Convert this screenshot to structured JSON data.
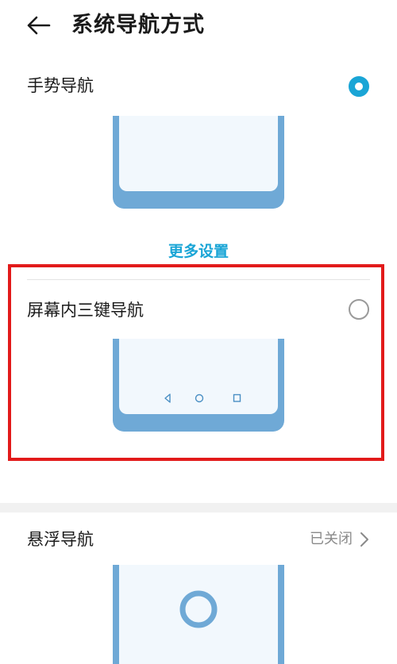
{
  "header": {
    "title": "系统导航方式"
  },
  "gesture_nav": {
    "label": "手势导航",
    "selected": true,
    "more_settings_label": "更多设置"
  },
  "three_key_nav": {
    "label": "屏幕内三键导航",
    "selected": false,
    "buttons": [
      "back-icon",
      "home-icon",
      "recents-icon"
    ]
  },
  "floating_nav": {
    "label": "悬浮导航",
    "status": "已关闭"
  },
  "colors": {
    "accent": "#1aa5d6",
    "phone_frame": "#6fa9d6",
    "highlight": "#e21a1a"
  }
}
